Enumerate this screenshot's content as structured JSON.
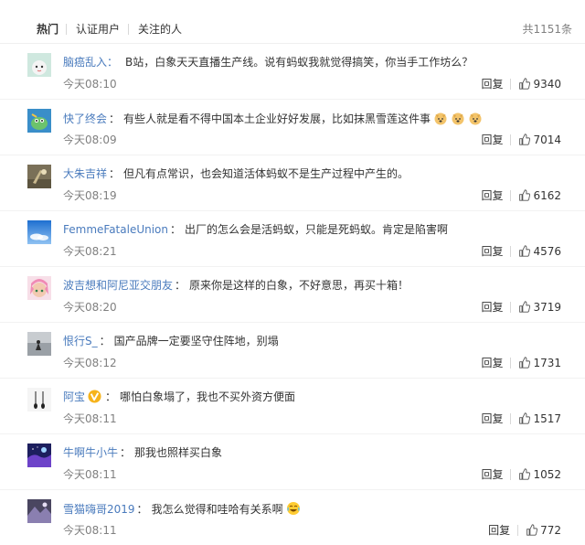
{
  "tabs": {
    "hot": "热门",
    "verified": "认证用户",
    "following": "关注的人",
    "total": "共1151条"
  },
  "comments": [
    {
      "user": "脑癌乱入：",
      "text": "B站，白象天天直播生产线。说有蚂蚁我就觉得搞笑，你当手工作坊么？",
      "time": "今天08:10",
      "reply": "回复",
      "likes": "9340"
    },
    {
      "user": "快了终会",
      "text": "有些人就是看不得中国本土企业好好发展，比如抹黑雪莲这件事",
      "time": "今天08:09",
      "reply": "回复",
      "likes": "7014"
    },
    {
      "user": "大朱吉祥",
      "text": "但凡有点常识，也会知道活体蚂蚁不是生产过程中产生的。",
      "time": "今天08:19",
      "reply": "回复",
      "likes": "6162"
    },
    {
      "user": "FemmeFataleUnion",
      "text": "出厂的怎么会是活蚂蚁，只能是死蚂蚁。肯定是陷害啊",
      "time": "今天08:21",
      "reply": "回复",
      "likes": "4576"
    },
    {
      "user": "波吉想和阿尼亚交朋友",
      "text": "原来你是这样的白象，不好意思，再买十箱！",
      "time": "今天08:20",
      "reply": "回复",
      "likes": "3719"
    },
    {
      "user": "恨行S_",
      "text": "国产品牌一定要坚守住阵地，别塌",
      "time": "今天08:12",
      "reply": "回复",
      "likes": "1731"
    },
    {
      "user": "阿宝",
      "text": "哪怕白象塌了，我也不买外资方便面",
      "time": "今天08:11",
      "reply": "回复",
      "likes": "1517"
    },
    {
      "user": "牛啊牛小牛",
      "text": "那我也照样买白象",
      "time": "今天08:11",
      "reply": "回复",
      "likes": "1052"
    },
    {
      "user": "雪猫嗨哥2019",
      "text": "我怎么觉得和哇哈有关系啊",
      "time": "今天08:11",
      "reply": "回复",
      "likes": "772"
    }
  ]
}
